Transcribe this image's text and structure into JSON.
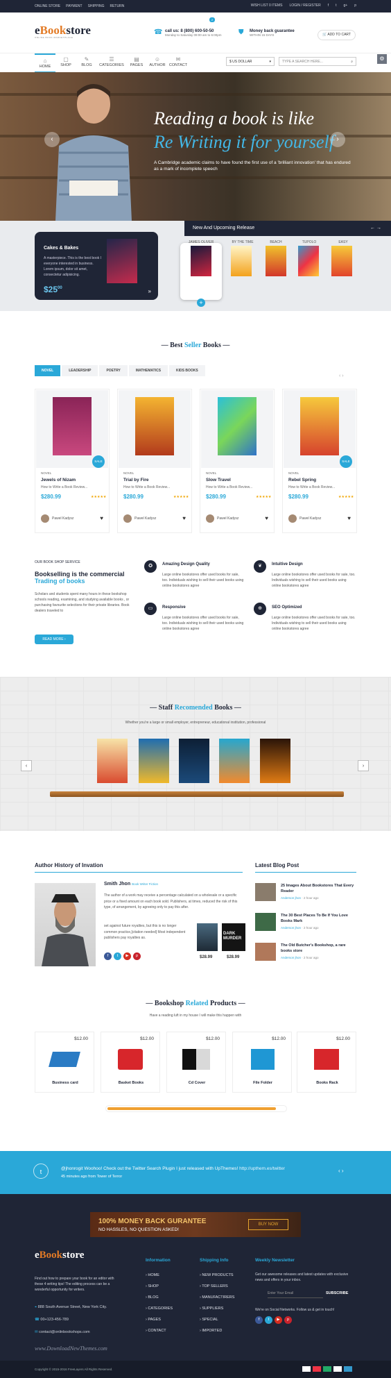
{
  "topbar": {
    "links": [
      "ONLINE STORE",
      "PAYMENT",
      "SHIPPING",
      "RETURN"
    ],
    "wishlist": "WISH LIST 0 ITEMS",
    "login": "LOGIN / REGISTER",
    "social": [
      "f",
      "t",
      "g+",
      "p"
    ]
  },
  "header": {
    "logo_e": "e",
    "logo_book": "Book",
    "logo_store": "store",
    "logo_tagline": "ONLINE BOOK MARKETPLACE",
    "phone": "call us: 8 (800) 600-50-50",
    "hours": "Monday to Saturday 09:00 am to 6:00pm",
    "guarantee": "Money back guarantee",
    "guarantee_sub": "WITHIN 15 DAYS",
    "cart": "ADD TO CART",
    "cart_count": "2"
  },
  "nav": {
    "items": [
      {
        "label": "HOME",
        "icon": "⌂"
      },
      {
        "label": "SHOP",
        "icon": "▢"
      },
      {
        "label": "BLOG",
        "icon": "✎"
      },
      {
        "label": "CATEGORIES",
        "icon": "☰"
      },
      {
        "label": "PAGES",
        "icon": "▤"
      },
      {
        "label": "AUTHOR",
        "icon": "☺"
      },
      {
        "label": "CONTACT",
        "icon": "✉"
      }
    ],
    "currency": "$ US DOLLAR",
    "search_placeholder": "TYPE A SEARCH HERE..."
  },
  "hero": {
    "line1": "Reading a book is like",
    "line2": "Re Writing it for yourself",
    "text": "A Cambridge academic claims to have found the first use of a 'brilliant innovation' that has endured as a mark of incomplete speech"
  },
  "release": {
    "title": "New And Upcoming Release",
    "card_title": "Cakes & Bakes",
    "card_text": "A masterpiece. This is the best book I everyone interested in business. Lorem ipsum, dolor sit amet, consectetur adipisicing.",
    "card_price_main": "$25",
    "card_price_cents": "00",
    "book_names": [
      "JAMES OLIVER",
      "BY THE TIME",
      "BEACH",
      "TUPOLO",
      "EASY"
    ]
  },
  "bestseller": {
    "title_a": "Best",
    "title_b": "Seller",
    "title_c": "Books",
    "tabs": [
      "NOVEL",
      "LEADERSHIP",
      "POETRY",
      "MATHEMATICS",
      "KIDS BOOKS"
    ],
    "products": [
      {
        "cat": "NOVEL",
        "title": "Jewels of Nizam",
        "desc": "How to Write a Book Review...",
        "price": "$280.99",
        "author": "Pawel Kadysz",
        "sale": true
      },
      {
        "cat": "NOVEL",
        "title": "Trial by Fire",
        "desc": "How to Write a Book Review...",
        "price": "$280.99",
        "author": "Pawel Kadysz",
        "sale": false
      },
      {
        "cat": "NOVEL",
        "title": "Slow Travel",
        "desc": "How to Write a Book Review...",
        "price": "$280.99",
        "author": "Pawel Kadysz",
        "sale": false
      },
      {
        "cat": "NOVEL",
        "title": "Rebel Spring",
        "desc": "How to Write a Book Review...",
        "price": "$280.99",
        "author": "Pawel Kadysz",
        "sale": true
      }
    ],
    "sale_label": "SALE",
    "stars": "★★★★★"
  },
  "service": {
    "kicker": "OUR BOOK SHOP SERVICE",
    "title_a": "Bookselling is the commercial",
    "title_b": "Trading of books",
    "text": "Scholars and students spent many hours in these bookshop schools reading, examining, and studying available books , or purchasing favourite selections for their private libraries. Book dealers traveled to",
    "btn": "READ MORE",
    "features": [
      {
        "title": "Amazing Design Quality",
        "text": "Large online bookstores offer used books for sale, too. Individuals wishing to sell their used books using online bookstores agree"
      },
      {
        "title": "Intuitive Design",
        "text": "Large online bookstores offer used books for sale, too. Individuals wishing to sell their used books using online bookstores agree"
      },
      {
        "title": "Responsive",
        "text": "Large online bookstores offer used books for sale, too. Individuals wishing to sell their used books using online bookstores agree"
      },
      {
        "title": "SEO Optimized",
        "text": "Large online bookstores offer used books for sale, too. Individuals wishing to sell their used books using online bookstores agree"
      }
    ]
  },
  "staff": {
    "title_a": "Staff",
    "title_b": "Recomended",
    "title_c": "Books",
    "sub": "Whether you're a large or small employer, entrepreneur, educational institution, professional"
  },
  "author": {
    "heading": "Author History of Invation",
    "name": "Smith Jhon",
    "role": "Book Writer Fiction",
    "p1": "The author of a work may receive a percentage calculated on a wholesale or a specific price or a fixed amount on each book sold. Publishers, at times, reduced the risk of this type, of arrangement, by agreeing only to pay this after.",
    "p2": "set against future royalties, but this is no longer common practice,[citation needed] Most independent publishers pay royalties as.",
    "prices": [
      "$28.99",
      "$28.99"
    ],
    "book2": "DARK MURDER"
  },
  "blog": {
    "heading": "Latest Blog Post",
    "posts": [
      {
        "title": "25 Images About Bookstores That Every Reader",
        "by": "Anderson jhon",
        "ago": "2 hour ago"
      },
      {
        "title": "The 30 Best Places To Be If You Love Books Mark",
        "by": "Anderson jhon",
        "ago": "2 hour ago"
      },
      {
        "title": "The Old Butcher's Bookshop, a rare books store",
        "by": "Anderson jhon",
        "ago": "2 hour ago"
      }
    ]
  },
  "related": {
    "title_a": "Bookshop",
    "title_b": "Related",
    "title_c": "Products",
    "sub": "Have a reading luft in my house I will make this happen with",
    "items": [
      {
        "name": "Business card",
        "price": "$12.00"
      },
      {
        "name": "Basket Books",
        "price": "$12.00"
      },
      {
        "name": "Cd Cover",
        "price": "$12.00"
      },
      {
        "name": "File Folder",
        "price": "$12.00"
      },
      {
        "name": "Books Rack",
        "price": "$12.00"
      }
    ],
    "scroll_fraction": 0.95
  },
  "twitter": {
    "handle": "@jhonrogit",
    "text": "Woohoo! Check out the Twitter Search Plugin I just released with UpThemes!",
    "link": "http://upthem.es/twitter",
    "time": "45 minutes ago from",
    "place": "Tower of Terror"
  },
  "banner": {
    "line1": "100% MONEY BACK GURANTEE",
    "line2": "NO HASSLES, NO QUESTION ASKED!",
    "btn": "BUY NOW"
  },
  "footer": {
    "about": "Find out how to prepare your book for an editor with these 4 writing tips! The editing process can be a wonderful opportunity for writers.",
    "address": "888 South Avenue Street, New York City.",
    "phone": "00+123-456-789",
    "email": "contact@onlinbookshops.com",
    "info_heading": "Information",
    "info_items": [
      "HOME",
      "SHOP",
      "BLOG",
      "CATEGORIES",
      "PAGES",
      "CONTACT"
    ],
    "ship_heading": "Shipping Info",
    "ship_items": [
      "NEW PRODUCTS",
      "TOP SELLERS",
      "MANUFACTIRERS",
      "SUPPLIERS",
      "SPECIAL",
      "IMPORTED"
    ],
    "news_heading": "Weekly Newsletter",
    "news_text": "Get our awesome releases and latest updates with exclusive news and offers in your inbox.",
    "email_placeholder": "Enter Your Email",
    "subscribe": "SUBSCRIBE",
    "social_text": "We're on Social Networks. Follow us & get in touch!",
    "watermark": "www.DownloadNewThemes.com",
    "copyright": "Copyright © 2015-2016 FreeLayers All Rights Reserved."
  }
}
